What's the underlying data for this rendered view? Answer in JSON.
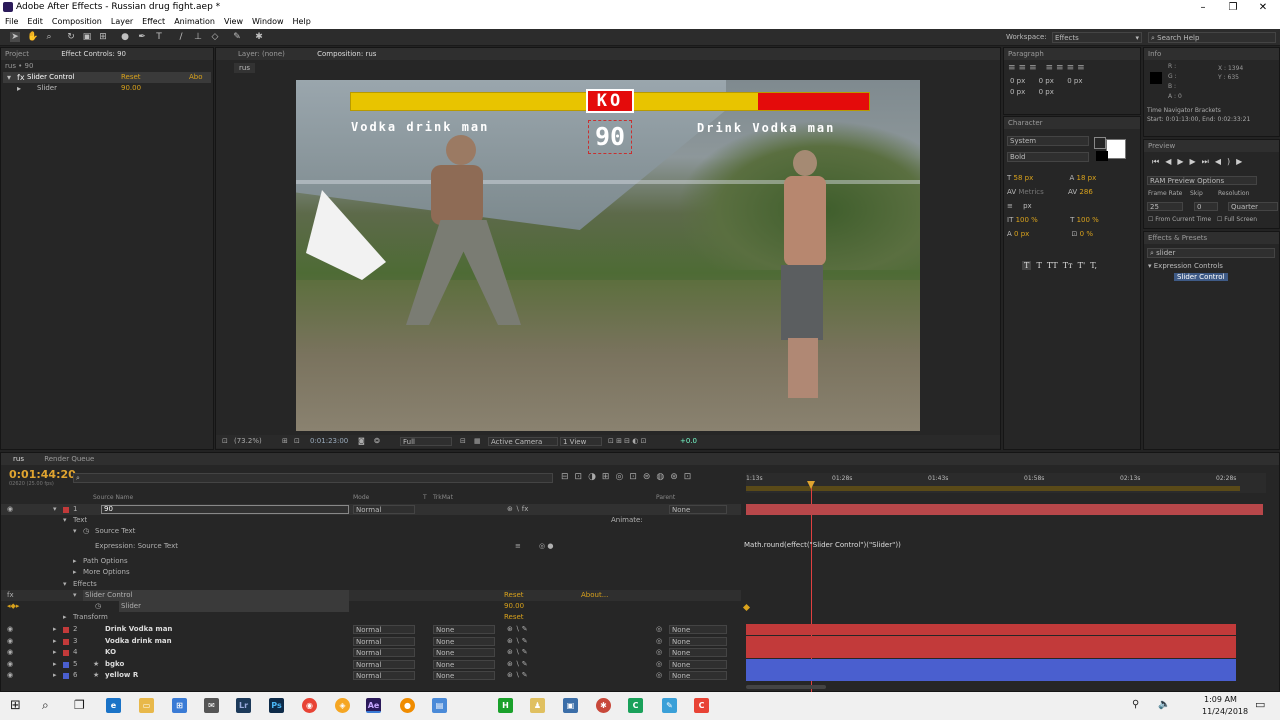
{
  "window": {
    "title": "Adobe After Effects - Russian drug fight.aep *",
    "minimize": "–",
    "maximize": "❐",
    "close": "✕"
  },
  "menu": [
    "File",
    "Edit",
    "Composition",
    "Layer",
    "Effect",
    "Animation",
    "View",
    "Window",
    "Help"
  ],
  "toolbar": {
    "workspace_label": "Workspace:",
    "workspace_value": "Effects",
    "search_placeholder": "Search Help"
  },
  "project_panel": {
    "tab_project": "Project",
    "tab_effect_controls": "Effect Controls: 90",
    "breadcrumb": "rus • 90",
    "effect_name": "Slider Control",
    "effect_reset": "Reset",
    "effect_about": "Abo",
    "slider_label": "Slider",
    "slider_value": "90.00"
  },
  "viewer": {
    "tab_layer": "Layer: (none)",
    "tab_composition": "Composition: rus",
    "comp_chip": "rus",
    "zoom": "(73.2%)",
    "timecode": "0:01:23:00",
    "resolution": "Full",
    "camera": "Active Camera",
    "views": "1 View",
    "exposure": "+0.0"
  },
  "frame": {
    "ko": "KO",
    "player_left": "Vodka drink man",
    "player_right": "Drink Vodka man",
    "counter": "90"
  },
  "paragraph": {
    "title": "Paragraph",
    "px1": "0 px",
    "px2": "0 px",
    "px3": "0 px",
    "px4": "0 px",
    "px5": "0 px"
  },
  "character": {
    "title": "Character",
    "font": "System",
    "style": "Bold",
    "size": "58 px",
    "leading": "18 px",
    "kerning": "Metrics",
    "tracking": "286",
    "stroke": "px",
    "vscale": "100 %",
    "hscale": "100 %",
    "baseline": "0 px",
    "tsume": "0 %",
    "styles": [
      "T",
      "T",
      "TT",
      "Tт",
      "T'",
      "T,"
    ]
  },
  "info": {
    "title": "Info",
    "r": "R :",
    "g": "G :",
    "b": "B :",
    "a": "A : 0",
    "x": "X : 1394",
    "y": "Y : 635",
    "nav_title": "Time Navigator Brackets",
    "nav_range": "Start: 0:01:13:00, End: 0:02:33:21"
  },
  "preview": {
    "title": "Preview",
    "ram_options": "RAM Preview Options",
    "frame_rate_label": "Frame Rate",
    "skip_label": "Skip",
    "resolution_label": "Resolution",
    "frame_rate": "25",
    "skip": "0",
    "resolution": "Quarter",
    "from_current": "From Current Time",
    "full_screen": "Full Screen"
  },
  "effects_presets": {
    "title": "Effects & Presets",
    "search_value": "slider",
    "category": "Expression Controls",
    "item": "Slider Control"
  },
  "timeline": {
    "tab_comp": "rus",
    "tab_render": "Render Queue",
    "timecode": "0:01:44:20",
    "fps": "02620 (25.00 fps)",
    "col_source": "Source Name",
    "col_mode": "Mode",
    "col_t": "T",
    "col_trkmat": "TrkMat",
    "col_parent": "Parent",
    "ruler": [
      "1:13s",
      "01:28s",
      "01:43s",
      "01:58s",
      "02:13s",
      "02:28s"
    ],
    "animate": "Animate:",
    "expression": "Math.round(effect(\"Slider Control\")(\"Slider\"))",
    "layer1": {
      "num": "1",
      "name": "90",
      "mode": "Normal",
      "parent": "None"
    },
    "props": {
      "text": "Text",
      "source_text": "Source Text",
      "expr_source": "Expression: Source Text",
      "path_options": "Path Options",
      "more_options": "More Options",
      "effects": "Effects",
      "slider_control": "Slider Control",
      "reset1": "Reset",
      "about": "About...",
      "slider": "Slider",
      "slider_val": "90.00",
      "transform": "Transform",
      "reset2": "Reset"
    },
    "layers": [
      {
        "num": "2",
        "name": "Drink Vodka man",
        "mode": "Normal",
        "trkmat": "None",
        "parent": "None",
        "color": "#c23a3a"
      },
      {
        "num": "3",
        "name": "Vodka drink man",
        "mode": "Normal",
        "trkmat": "None",
        "parent": "None",
        "color": "#c23a3a"
      },
      {
        "num": "4",
        "name": "KO",
        "mode": "Normal",
        "trkmat": "None",
        "parent": "None",
        "color": "#c23a3a"
      },
      {
        "num": "5",
        "name": "bgko",
        "mode": "Normal",
        "trkmat": "None",
        "parent": "None",
        "color": "#4a5fcf"
      },
      {
        "num": "6",
        "name": "yellow R",
        "mode": "Normal",
        "trkmat": "None",
        "parent": "None",
        "color": "#4a5fcf"
      }
    ]
  },
  "taskbar": {
    "time": "1:09 AM",
    "date": "11/24/2018"
  }
}
